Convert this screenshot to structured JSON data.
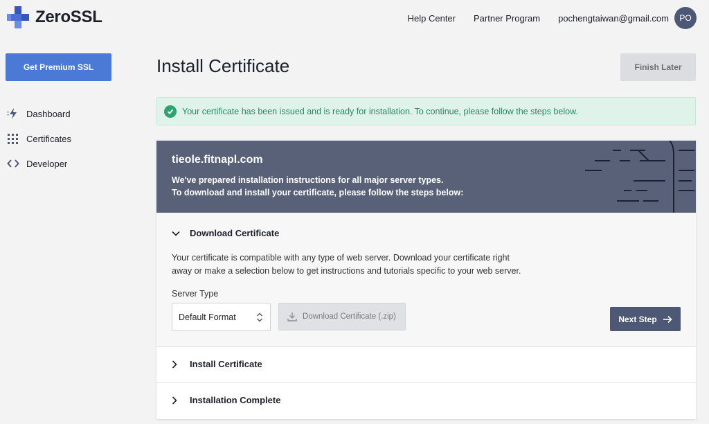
{
  "brand": {
    "name": "ZeroSSL",
    "accent": "#4a7ad5",
    "dark": "#4d5874"
  },
  "topnav": {
    "help_center": "Help Center",
    "partner_program": "Partner Program",
    "email": "pochengtaiwan@gmail.com",
    "avatar_initials": "PO"
  },
  "sidebar": {
    "premium_button": "Get Premium SSL",
    "items": [
      {
        "label": "Dashboard",
        "icon": "bolt-icon"
      },
      {
        "label": "Certificates",
        "icon": "grid-icon"
      },
      {
        "label": "Developer",
        "icon": "code-icon"
      }
    ]
  },
  "page": {
    "title": "Install Certificate",
    "finish_later": "Finish Later"
  },
  "alert": {
    "status": "success",
    "text": "Your certificate has been issued and is ready for installation. To continue, please follow the steps below."
  },
  "card": {
    "domain": "tieole.fitnapl.com",
    "desc_line1": "We've prepared installation instructions for all major server types.",
    "desc_line2": "To download and install your certificate, please follow the steps below:"
  },
  "steps": [
    {
      "title": "Download Certificate",
      "expanded": true,
      "body_line1": "Your certificate is compatible with any type of web server. Download your certificate right",
      "body_line2": "away or make a selection below to get instructions and tutorials specific to your web server.",
      "server_type_label": "Server Type",
      "server_type_value": "Default Format",
      "download_button": "Download Certificate (.zip)",
      "next_button": "Next Step"
    },
    {
      "title": "Install Certificate",
      "expanded": false
    },
    {
      "title": "Installation Complete",
      "expanded": false
    }
  ]
}
